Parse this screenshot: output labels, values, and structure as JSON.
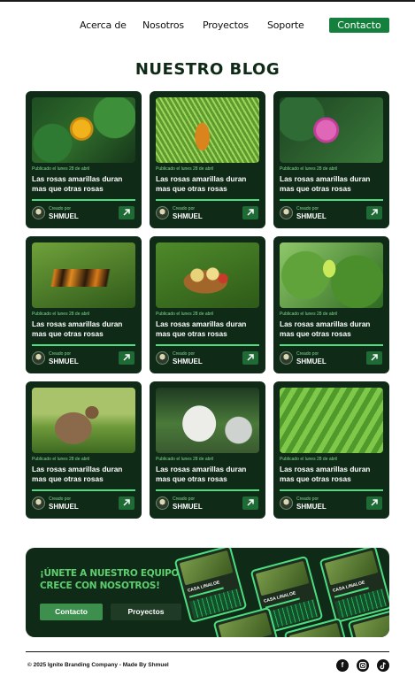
{
  "nav": {
    "items": [
      "Acerca de",
      "Nosotros",
      "Proyectos",
      "Soporte"
    ],
    "cta": "Contacto"
  },
  "blog": {
    "title": "NUESTRO BLOG",
    "cards": [
      {
        "image": "yellow-rose-photo",
        "date": "Publicado el lunes 28 de abril",
        "title": "Las rosas amarillas duran mas que otras rosas",
        "by": "Creado por",
        "author": "SHMUEL"
      },
      {
        "image": "pine-cone-photo",
        "date": "Publicado el lunes 28 de abril",
        "title": "Las rosas amarillas duran mas que otras rosas",
        "by": "Creado por",
        "author": "SHMUEL"
      },
      {
        "image": "pink-flower-photo",
        "date": "Publicado el lunes 28 de abril",
        "title": "Las rosas amarillas duran mas que otras rosas",
        "by": "Creado por",
        "author": "SHMUEL"
      },
      {
        "image": "butterfly-photo",
        "date": "Publicado el lunes 28 de abril",
        "title": "Las rosas amarillas duran mas que otras rosas",
        "by": "Creado por",
        "author": "SHMUEL"
      },
      {
        "image": "fruit-basket-photo",
        "date": "Publicado el lunes 28 de abril",
        "title": "Las rosas amarillas duran mas que otras rosas",
        "by": "Creado por",
        "author": "SHMUEL"
      },
      {
        "image": "caterpillar-photo",
        "date": "Publicado el lunes 28 de abril",
        "title": "Las rosas amarillas duran mas que otras rosas",
        "by": "Creado por",
        "author": "SHMUEL"
      },
      {
        "image": "deer-photo",
        "date": "Publicado el lunes 28 de abril",
        "title": "Las rosas amarillas duran mas que otras rosas",
        "by": "Creado por",
        "author": "SHMUEL"
      },
      {
        "image": "white-wolf-photo",
        "date": "Publicado el lunes 28 de abril",
        "title": "Las rosas amarillas duran mas que otras rosas",
        "by": "Creado por",
        "author": "SHMUEL"
      },
      {
        "image": "green-plant-photo",
        "date": "Publicado el lunes 28 de abril",
        "title": "Las rosas amarillas duran mas que otras rosas",
        "by": "Creado por",
        "author": "SHMUEL"
      }
    ]
  },
  "banner": {
    "headline": "¡ÚNETE A NUESTRO EQUIPO Y CRECE CON NOSOTROS!",
    "primary_button": "Contacto",
    "secondary_button": "Proyectos",
    "mockup_title": "CASA LINALOE"
  },
  "footer": {
    "text": "© 2025 Ignite Branding Company - Made By Shmuel",
    "social": [
      "facebook-icon",
      "instagram-icon",
      "tiktok-icon"
    ]
  },
  "colors": {
    "brand_green": "#15803d",
    "card_bg": "#0f2a17",
    "accent": "#4ade80"
  }
}
